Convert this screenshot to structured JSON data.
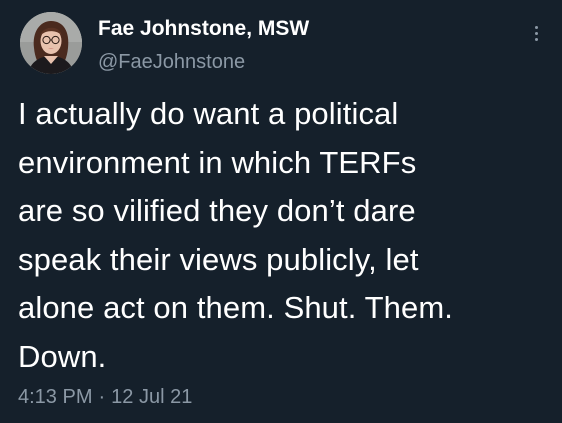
{
  "tweet": {
    "author": {
      "display_name": "Fae Johnstone, MSW",
      "handle": "@FaeJohnstone",
      "avatar_icon": "profile-photo"
    },
    "menu_icon": "more-vertical-icon",
    "text_lines": [
      "I actually do want a political",
      "environment in which TERFs",
      "are so vilified they don’t dare",
      "speak their views publicly, let",
      "alone act on them. Shut. Them.",
      "Down."
    ],
    "time": "4:13 PM",
    "separator": "·",
    "date": "12 Jul 21"
  },
  "colors": {
    "background": "#15202b",
    "primary_text": "#ffffff",
    "secondary_text": "#8b98a5"
  }
}
